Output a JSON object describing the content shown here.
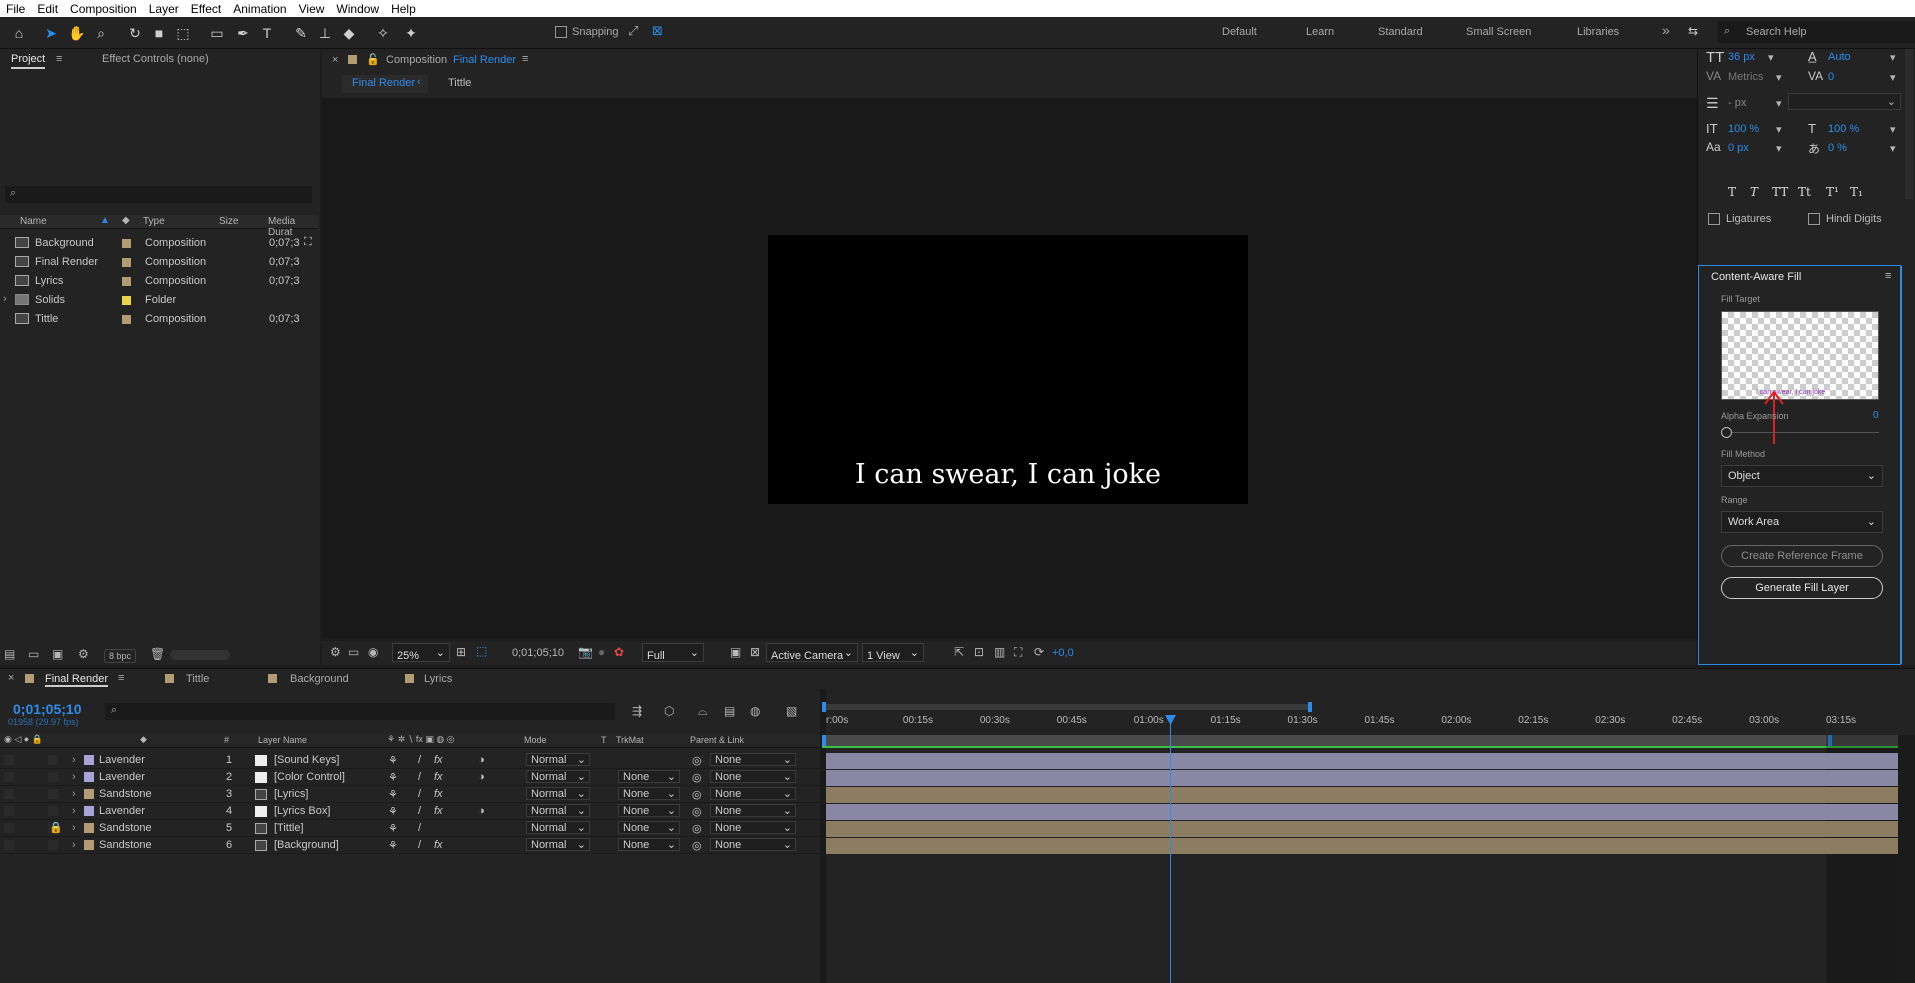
{
  "menu": [
    "File",
    "Edit",
    "Composition",
    "Layer",
    "Effect",
    "Animation",
    "View",
    "Window",
    "Help"
  ],
  "toolbar": {
    "snapping": "Snapping",
    "workspaces": [
      "Default",
      "Learn",
      "Standard",
      "Small Screen",
      "Libraries"
    ],
    "more": "»",
    "search_placeholder": "Search Help"
  },
  "project": {
    "tab_project": "Project",
    "tab_effect_controls": "Effect Controls (none)",
    "columns": {
      "name": "Name",
      "type": "Type",
      "size": "Size",
      "duration": "Media Durat"
    },
    "items": [
      {
        "name": "Background",
        "type": "Composition",
        "duration": "0;07;3",
        "chip": "#b39b74"
      },
      {
        "name": "Final Render",
        "type": "Composition",
        "duration": "0;07;3",
        "chip": "#b39b74"
      },
      {
        "name": "Lyrics",
        "type": "Composition",
        "duration": "0;07;3",
        "chip": "#b39b74"
      },
      {
        "name": "Solids",
        "type": "Folder",
        "duration": "",
        "chip": "#e8d34a"
      },
      {
        "name": "Tittle",
        "type": "Composition",
        "duration": "0;07;3",
        "chip": "#b39b74"
      }
    ],
    "bpc": "8 bpc"
  },
  "viewer": {
    "header_prefix": "Composition",
    "comp_name": "Final Render",
    "breadcrumb_active": "Final Render",
    "breadcrumb_next": "Tittle",
    "caption": "I can swear, I can joke",
    "zoom": "25%",
    "timecode": "0;01;05;10",
    "resolution": "Full",
    "camera": "Active Camera",
    "views": "1 View",
    "exposure": "+0,0"
  },
  "character": {
    "font_size": "36 px",
    "leading": "Auto",
    "kerning": "Metrics",
    "tracking": "0",
    "stroke": "- px",
    "vscale": "100 %",
    "hscale": "100 %",
    "baseline": "0 px",
    "tsume": "0 %",
    "ligatures": "Ligatures",
    "hindi_digits": "Hindi Digits",
    "styles": [
      "T",
      "T",
      "TT",
      "Tt",
      "T¹",
      "T₁"
    ]
  },
  "caf": {
    "title": "Content-Aware Fill",
    "fill_target": "Fill Target",
    "thumb_text": "I can swear, I can joke",
    "alpha_label": "Alpha Expansion",
    "alpha_value": "0",
    "alpha_position": 0,
    "fill_method_label": "Fill Method",
    "fill_method": "Object",
    "range_label": "Range",
    "range": "Work Area",
    "create_ref": "Create Reference Frame",
    "generate": "Generate Fill Layer"
  },
  "timeline": {
    "tabs": [
      "Final Render",
      "Tittle",
      "Background",
      "Lyrics"
    ],
    "tab_colors": [
      "#b39b74",
      "#b39b74",
      "#b39b74",
      "#b39b74"
    ],
    "timecode": "0;01;05;10",
    "fps": "01958 (29.97 fps)",
    "headers": {
      "num": "#",
      "layer_name": "Layer Name",
      "mode": "Mode",
      "t": "T",
      "trkmat": "TrkMat",
      "parent": "Parent & Link"
    },
    "ruler": [
      "r:00s",
      "00:15s",
      "00:30s",
      "00:45s",
      "01:00s",
      "01:15s",
      "01:30s",
      "01:45s",
      "02:00s",
      "02:15s",
      "02:30s",
      "02:45s",
      "03:00s",
      "03:15s"
    ],
    "layers": [
      {
        "label": "Lavender",
        "color": "#a9a3d6",
        "num": "1",
        "name": "[Sound Keys]",
        "mode": "Normal",
        "trkmat": "",
        "parent": "None",
        "bar": "#8a87a5"
      },
      {
        "label": "Lavender",
        "color": "#a9a3d6",
        "num": "2",
        "name": "[Color Control]",
        "mode": "Normal",
        "trkmat": "None",
        "parent": "None",
        "bar": "#8a87a5"
      },
      {
        "label": "Sandstone",
        "color": "#b39b74",
        "num": "3",
        "name": "[Lyrics]",
        "mode": "Normal",
        "trkmat": "None",
        "parent": "None",
        "bar": "#8c7d62"
      },
      {
        "label": "Lavender",
        "color": "#a9a3d6",
        "num": "4",
        "name": "[Lyrics Box]",
        "mode": "Normal",
        "trkmat": "None",
        "parent": "None",
        "bar": "#8a87a5"
      },
      {
        "label": "Sandstone",
        "color": "#b39b74",
        "num": "5",
        "name": "[Tittle]",
        "mode": "Normal",
        "trkmat": "None",
        "parent": "None",
        "bar": "#8c7d62"
      },
      {
        "label": "Sandstone",
        "color": "#b39b74",
        "num": "6",
        "name": "[Background]",
        "mode": "Normal",
        "trkmat": "None",
        "parent": "None",
        "bar": "#8c7d62"
      }
    ]
  }
}
